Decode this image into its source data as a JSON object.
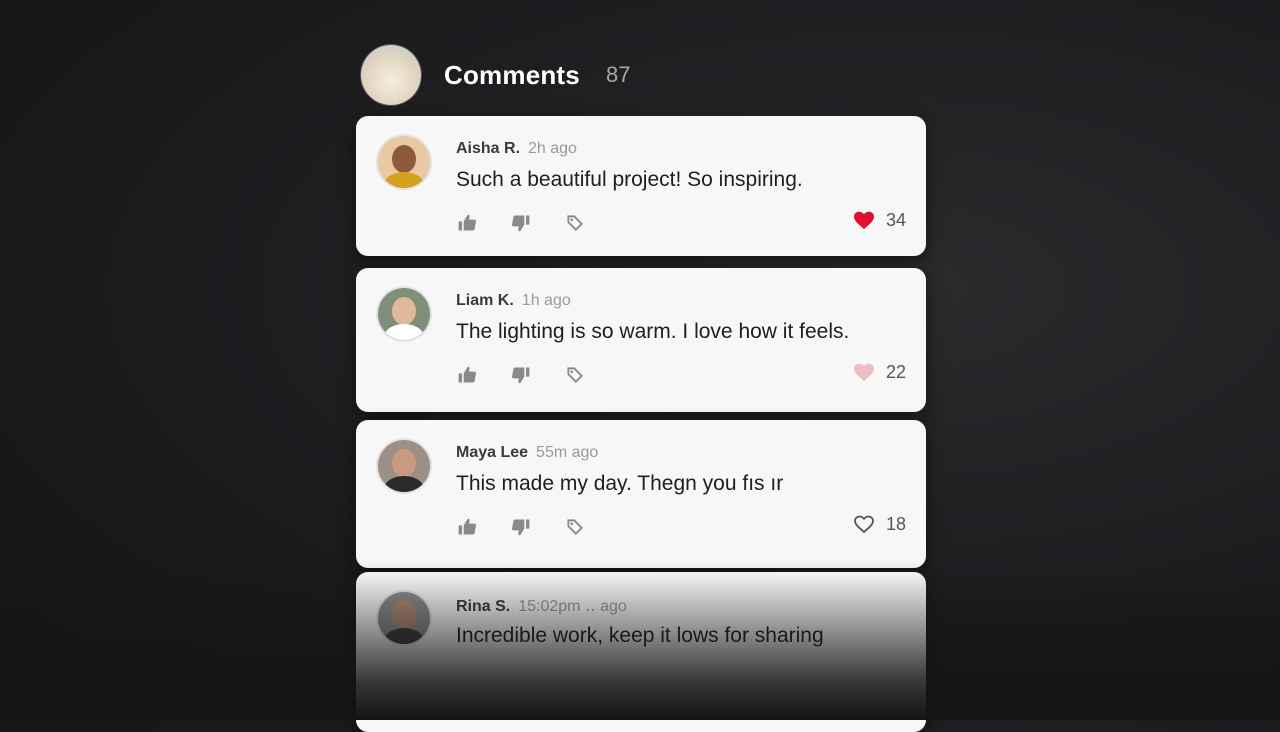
{
  "header": {
    "title": "Comments",
    "count": "87"
  },
  "comments": [
    {
      "name": "Aisha R.",
      "time": "2h ago",
      "text": "Such a beautiful project! So inspiring.",
      "likes": "34",
      "liked": true,
      "avatar_colors": {
        "bg": "#e8c9a4",
        "head": "#8a5a3a",
        "body": "#d4a020"
      }
    },
    {
      "name": "Liam K.",
      "time": "1h ago",
      "text": "The lighting is so warm. I love how it feels.",
      "likes": "22",
      "liked": "soft",
      "avatar_colors": {
        "bg": "#7f8f7a",
        "head": "#e0b99a",
        "body": "#ffffff"
      }
    },
    {
      "name": "Maya Lee",
      "time": "55m ago",
      "text": "This made my day. Thegn you fıs ır",
      "likes": "18",
      "liked": false,
      "avatar_colors": {
        "bg": "#9b8f88",
        "head": "#c99a80",
        "body": "#2a2a2a"
      }
    },
    {
      "name": "Rina S.",
      "time": "15:02pm ․․ ago",
      "text": "Incredible work, keep it lows for sharing",
      "likes": "",
      "liked": false,
      "avatar_colors": {
        "bg": "#8a8a8a",
        "head": "#b08a70",
        "body": "#3a3a3a"
      }
    }
  ],
  "icons": {
    "thumbs_up": "thumbs-up-icon",
    "thumbs_down": "thumbs-down-icon",
    "tag": "tag-icon",
    "heart": "heart-icon"
  },
  "colors": {
    "heart_liked": "#e0112f",
    "heart_soft": "#efbcc4",
    "heart_outline": "#555555"
  }
}
